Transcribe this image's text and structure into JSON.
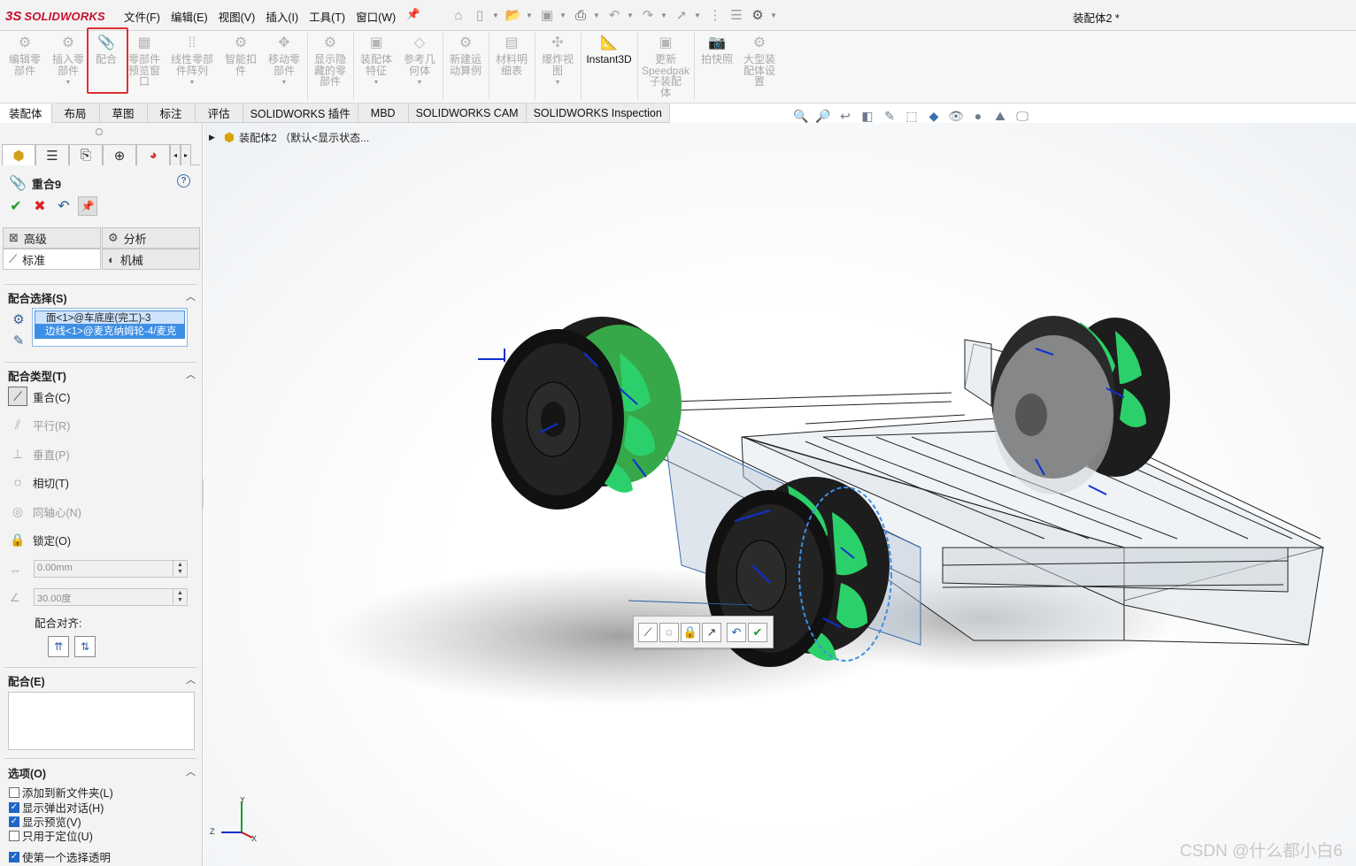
{
  "app": {
    "logo_ds": "3S",
    "logo_text": "SOLIDWORKS",
    "doc_title": "装配体2 *",
    "brand_color": "#c8102e"
  },
  "menu": [
    "文件(F)",
    "编辑(E)",
    "视图(V)",
    "插入(I)",
    "工具(T)",
    "窗口(W)"
  ],
  "quick_icons": [
    "home-icon",
    "new-icon",
    "open-icon",
    "save-icon",
    "print-icon",
    "undo-icon",
    "redo-icon",
    "select-icon",
    "traffic-light-icon",
    "file-props-icon",
    "options-gear-icon"
  ],
  "commands": [
    {
      "label": "编辑零\n部件",
      "icon": "edit-part-icon",
      "active": false
    },
    {
      "label": "插入零\n部件",
      "icon": "insert-part-icon",
      "active": false
    },
    {
      "label": "配合",
      "icon": "mate-paperclip-icon",
      "active": false
    },
    {
      "label": "零部件\n预览窗\n口",
      "icon": "preview-window-icon",
      "active": false
    },
    {
      "label": "线性零部\n件阵列",
      "icon": "linear-pattern-icon",
      "active": false
    },
    {
      "label": "智能扣\n件",
      "icon": "smart-fastener-icon",
      "active": false
    },
    {
      "label": "移动零\n部件",
      "icon": "move-part-icon",
      "active": false
    },
    {
      "label": "显示隐\n藏的零\n部件",
      "icon": "show-hidden-icon",
      "active": false
    },
    {
      "label": "装配体\n特征",
      "icon": "assembly-feature-icon",
      "active": false
    },
    {
      "label": "参考几\n何体",
      "icon": "ref-geometry-icon",
      "active": false
    },
    {
      "label": "新建运\n动算例",
      "icon": "motion-study-icon",
      "active": false
    },
    {
      "label": "材料明\n细表",
      "icon": "bom-icon",
      "active": false
    },
    {
      "label": "爆炸视\n图",
      "icon": "explode-icon",
      "active": false
    },
    {
      "label": "Instant3D",
      "icon": "instant3d-icon",
      "active": true
    },
    {
      "label": "更新\nSpeedpak\n子装配\n体",
      "icon": "speedpak-icon",
      "active": false
    },
    {
      "label": "拍快照",
      "icon": "snapshot-icon",
      "active": false
    },
    {
      "label": "大型装\n配体设\n置",
      "icon": "large-assembly-icon",
      "active": false
    }
  ],
  "tabs": [
    "装配体",
    "布局",
    "草图",
    "标注",
    "评估",
    "SOLIDWORKS 插件",
    "MBD",
    "SOLIDWORKS CAM",
    "SOLIDWORKS Inspection"
  ],
  "view_icons": [
    "zoom-fit-icon",
    "zoom-area-icon",
    "prev-view-icon",
    "section-view-icon",
    "dynamic-annotation-icon",
    "view-orientation-icon",
    "display-style-icon",
    "hide-show-icon",
    "edit-appearance-icon",
    "scene-icon",
    "view-settings-icon"
  ],
  "property_manager": {
    "title": "重合9",
    "advanced_tab": "高级",
    "analysis_tab": "分析",
    "standard_tab": "标准",
    "mechanical_tab": "机械",
    "mate_selection_header": "配合选择(S)",
    "selections": [
      "面<1>@车底座(完工)-3",
      "边线<1>@麦克纳姆轮-4/麦克"
    ],
    "mate_types_header": "配合类型(T)",
    "mate_types": [
      {
        "label": "重合(C)",
        "icon": "coincident-icon"
      },
      {
        "label": "平行(R)",
        "icon": "parallel-icon"
      },
      {
        "label": "垂直(P)",
        "icon": "perpendicular-icon"
      },
      {
        "label": "相切(T)",
        "icon": "tangent-icon"
      },
      {
        "label": "同轴心(N)",
        "icon": "concentric-icon"
      },
      {
        "label": "锁定(O)",
        "icon": "lock-icon"
      }
    ],
    "distance_value": "0.00mm",
    "angle_value": "30.00度",
    "alignment_label": "配合对齐:",
    "mates_header": "配合(E)",
    "options_header": "选项(O)",
    "options": [
      {
        "label": "添加到新文件夹(L)",
        "checked": false
      },
      {
        "label": "显示弹出对话(H)",
        "checked": true
      },
      {
        "label": "显示预览(V)",
        "checked": true
      },
      {
        "label": "只用于定位(U)",
        "checked": false
      },
      {
        "label": "使第一个选择透明",
        "checked": true
      }
    ]
  },
  "canvas": {
    "tree_item": "装配体2 （默认<显示状态...",
    "triad_x": "X",
    "triad_y": "Y",
    "triad_z": "Z",
    "watermark": "CSDN @什么都小白6"
  }
}
